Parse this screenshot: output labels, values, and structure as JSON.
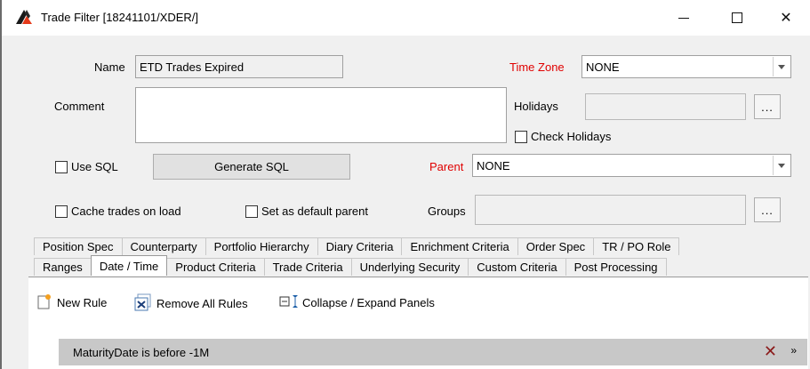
{
  "window": {
    "title": "Trade Filter [18241101/XDER/]"
  },
  "form": {
    "name_label": "Name",
    "name_value": "ETD Trades Expired",
    "comment_label": "Comment",
    "timezone_label": "Time Zone",
    "timezone_value": "NONE",
    "holidays_label": "Holidays",
    "holidays_button": "...",
    "check_holidays_label": "Check Holidays",
    "use_sql_label": "Use SQL",
    "generate_sql_label": "Generate SQL",
    "parent_label": "Parent",
    "parent_value": "NONE",
    "cache_trades_label": "Cache trades on load",
    "set_default_parent_label": "Set as default parent",
    "groups_label": "Groups",
    "groups_button": "..."
  },
  "tabs_row1": [
    "Position Spec",
    "Counterparty",
    "Portfolio Hierarchy",
    "Diary Criteria",
    "Enrichment Criteria",
    "Order Spec",
    "TR / PO Role"
  ],
  "tabs_row2": [
    "Ranges",
    "Date / Time",
    "Product Criteria",
    "Trade Criteria",
    "Underlying Security",
    "Custom Criteria",
    "Post Processing"
  ],
  "active_tab": "Date / Time",
  "toolbar": {
    "new_rule": "New Rule",
    "remove_all_rules": "Remove All Rules",
    "collapse_expand": "Collapse / Expand Panels"
  },
  "rules": [
    {
      "text": "MaturityDate is before -1M"
    }
  ],
  "colors": {
    "required_label": "#e00000",
    "dialog_bg": "#f0f0f0",
    "rule_bar": "#c8c8c8",
    "remove_x": "#8b1a1a"
  }
}
